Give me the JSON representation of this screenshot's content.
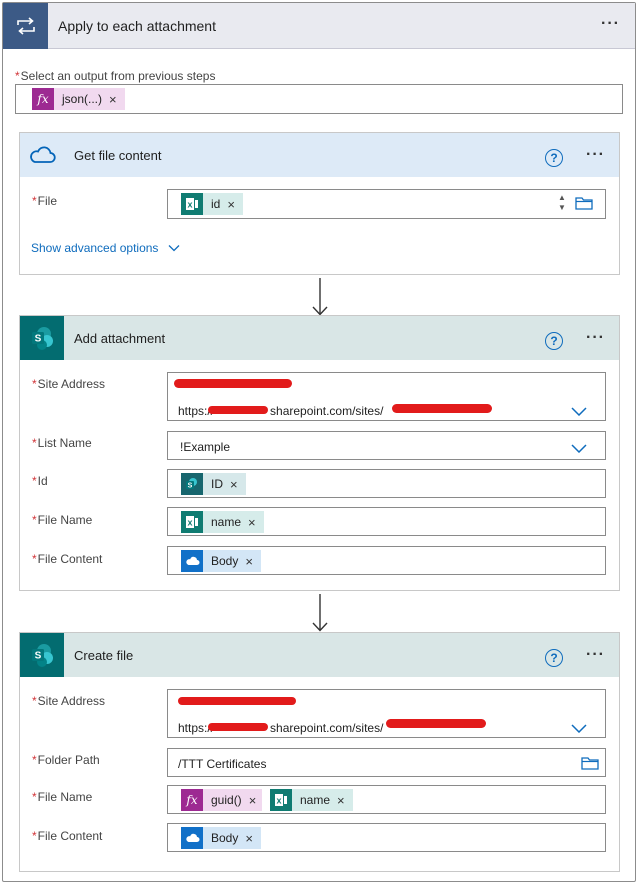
{
  "loop": {
    "title": "Apply to each attachment",
    "more": "···",
    "select_label": "Select an output from previous steps",
    "token": "json(...)"
  },
  "get_file": {
    "title": "Get file content",
    "help": "?",
    "more": "···",
    "file_label": "File",
    "file_token": "id",
    "advanced": "Show advanced options"
  },
  "add_attachment": {
    "title": "Add attachment",
    "help": "?",
    "more": "···",
    "site_label": "Site Address",
    "site_url_a": "https://",
    "site_url_b": "sharepoint.com/sites/",
    "list_label": "List Name",
    "list_value": "!Example",
    "id_label": "Id",
    "id_token": "ID",
    "filename_label": "File Name",
    "filename_token": "name",
    "content_label": "File Content",
    "content_token": "Body"
  },
  "create_file": {
    "title": "Create file",
    "help": "?",
    "more": "···",
    "site_label": "Site Address",
    "site_url_a": "https://",
    "site_url_b": "sharepoint.com/sites/",
    "folder_label": "Folder Path",
    "folder_value": "/TTT Certificates",
    "filename_label": "File Name",
    "filename_token1": "guid()",
    "filename_token2": "name",
    "content_label": "File Content",
    "content_token": "Body"
  },
  "colors": {
    "loop_header": "#3c5a86",
    "onedrive_header": "#ddeaf7",
    "sharepoint_header": "#d9e6e6",
    "sharepoint_icon": "#036c70",
    "onedrive_icon": "#0364b8",
    "required_star": "#d13438",
    "link": "#0f6cbd"
  }
}
